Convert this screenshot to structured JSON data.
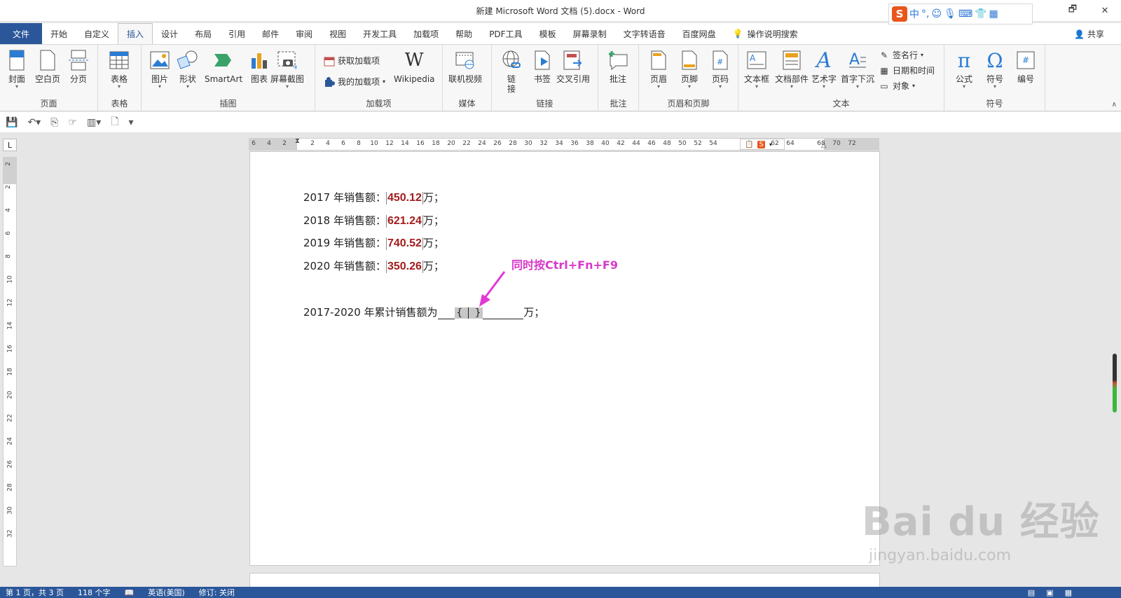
{
  "window": {
    "title": "新建 Microsoft Word 文档 (5).docx  -  Word",
    "controls": [
      "🗗",
      "✕"
    ]
  },
  "ime": {
    "lang": "中",
    "punct": "°,",
    "icons": [
      "smile-icon",
      "mic-icon",
      "keyboard-icon",
      "shirt-icon",
      "grid-icon"
    ]
  },
  "tabs": [
    "文件",
    "开始",
    "自定义",
    "插入",
    "设计",
    "布局",
    "引用",
    "邮件",
    "审阅",
    "视图",
    "开发工具",
    "加载项",
    "帮助",
    "PDF工具",
    "模板",
    "屏幕录制",
    "文字转语音",
    "百度网盘"
  ],
  "active_tab": "插入",
  "tell_me": "操作说明搜索",
  "share": "共享",
  "ribbon": {
    "groups": {
      "pages": {
        "name": "页面",
        "buttons": [
          "封面",
          "空白页",
          "分页"
        ]
      },
      "tables": {
        "name": "表格",
        "buttons": [
          "表格"
        ]
      },
      "illustrations": {
        "name": "插图",
        "buttons": [
          "图片",
          "形状",
          "SmartArt",
          "图表",
          "屏幕截图"
        ]
      },
      "addins": {
        "name": "加载项",
        "get": "获取加载项",
        "my": "我的加载项",
        "wiki": "Wikipedia",
        "wiki_logo": "W"
      },
      "media": {
        "name": "媒体",
        "buttons": [
          "联机视频"
        ]
      },
      "links": {
        "name": "链接",
        "buttons": [
          "链接",
          "书签",
          "交叉引用"
        ],
        "link_l1": "链",
        "link_l2": "接"
      },
      "comments": {
        "name": "批注",
        "buttons": [
          "批注"
        ]
      },
      "header_footer": {
        "name": "页眉和页脚",
        "buttons": [
          "页眉",
          "页脚",
          "页码"
        ]
      },
      "text": {
        "name": "文本",
        "buttons": [
          "文本框",
          "文档部件",
          "艺术字",
          "首字下沉"
        ],
        "small": [
          "签名行",
          "日期和时间",
          "对象"
        ]
      },
      "symbols": {
        "name": "符号",
        "buttons": [
          "公式",
          "符号",
          "编号"
        ]
      }
    }
  },
  "ruler": {
    "left_ticks": [
      "6",
      "4",
      "2"
    ],
    "right_ticks": [
      "2",
      "4",
      "6",
      "8",
      "10",
      "12",
      "14",
      "16",
      "18",
      "20",
      "22",
      "24",
      "26",
      "28",
      "30",
      "32",
      "34",
      "36",
      "38",
      "40",
      "42",
      "44",
      "46",
      "48",
      "50",
      "52",
      "54",
      "62",
      "64",
      "68",
      "70",
      "72"
    ],
    "vertical_ticks": [
      "2",
      "2",
      "4",
      "6",
      "8",
      "10",
      "12",
      "14",
      "16",
      "18",
      "20",
      "22",
      "24",
      "26",
      "28",
      "30",
      "32"
    ],
    "corner": "L"
  },
  "document": {
    "lines": [
      {
        "prefix": "2017 年销售额：",
        "value": "450.12",
        "suffix": "万；"
      },
      {
        "prefix": "2018 年销售额：",
        "value": "621.24",
        "suffix": "万；"
      },
      {
        "prefix": "2019 年销售额：",
        "value": "740.52",
        "suffix": "万；"
      },
      {
        "prefix": "2020 年销售额：",
        "value": "350.26",
        "suffix": "万；"
      }
    ],
    "total": {
      "prefix": "2017-2020 年累计销售额为",
      "open_brace": "{",
      "close_brace": "}",
      "suffix": "万；"
    },
    "annotation": "同时按Ctrl+Fn+F9"
  },
  "watermark": {
    "line1": "Bai  du 经验",
    "line2": "jingyan.baidu.com"
  },
  "status": {
    "page": "第 1 页，共 3 页",
    "words": "118 个字",
    "lang": "英语(美国)",
    "track": "修订: 关闭"
  },
  "colors": {
    "accent": "#2b579a",
    "field_value": "#a31c1c",
    "annotation": "#d63ac9"
  }
}
